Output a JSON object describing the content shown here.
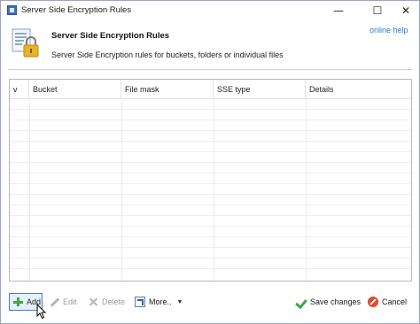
{
  "window": {
    "title": "Server Side Encryption Rules",
    "controls": {
      "minimize": "—",
      "maximize": "☐",
      "close": "✕"
    }
  },
  "header": {
    "icon": "lock-document-icon",
    "title": "Server Side Encryption Rules",
    "description": "Server Side Encryption rules for buckets, folders or individual files",
    "help_link": "online help"
  },
  "grid": {
    "columns": [
      "v",
      "Bucket",
      "File mask",
      "SSE type",
      "Details"
    ],
    "rows": []
  },
  "toolbar": {
    "add_label": "Add",
    "edit_label": "Edit",
    "delete_label": "Delete",
    "more_label": "More..",
    "save_label": "Save changes",
    "cancel_label": "Cancel"
  },
  "colors": {
    "accent": "#3d7fd0",
    "link": "#3a78c9",
    "add_green": "#3aa84a",
    "cancel_red": "#e04a2e",
    "disabled": "#9a9a9a"
  }
}
